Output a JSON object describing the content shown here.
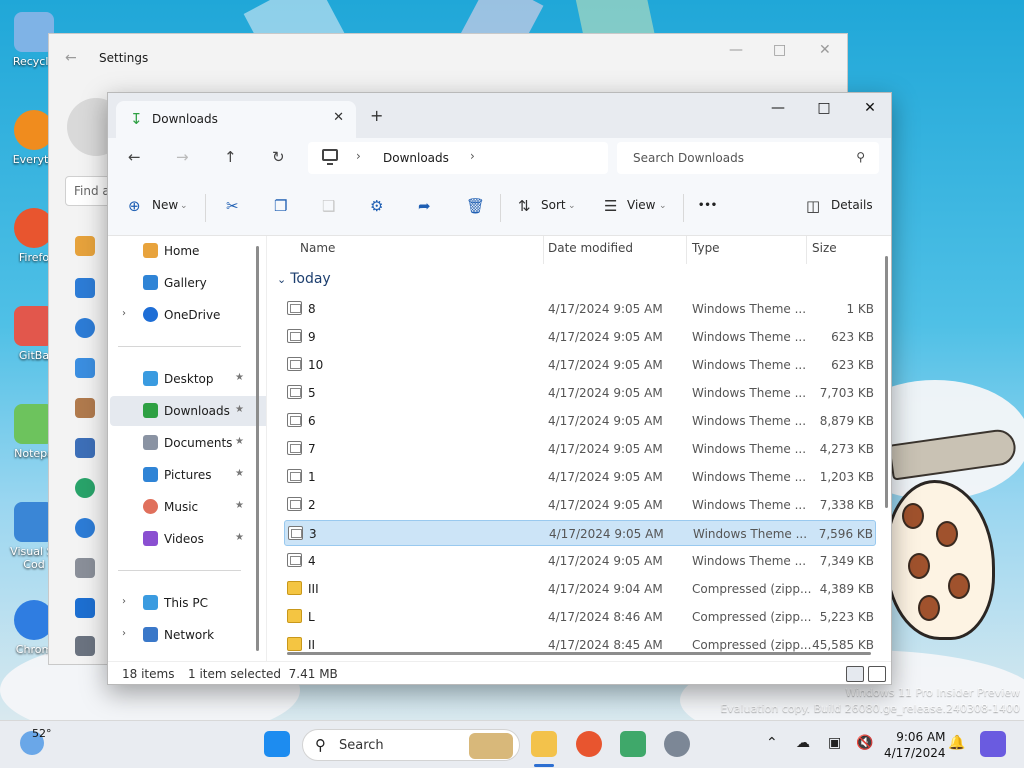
{
  "desktop": {
    "icons": [
      {
        "label": "Recycle",
        "color": "#7fb3e6"
      },
      {
        "label": "Everyth",
        "color": "#f08c1e"
      },
      {
        "label": "Firefo",
        "color": "#e8552f"
      },
      {
        "label": "GitBa",
        "color": "#e2574c"
      },
      {
        "label": "Notepa",
        "color": "#6dc35d"
      },
      {
        "label": "Visual St Cod",
        "color": "#3a86d6"
      },
      {
        "label": "Chrom",
        "color": "#2f7de1"
      }
    ],
    "watermark": {
      "line1": "Windows 11 Pro Insider Preview",
      "line2": "Evaluation copy. Build 26080.ge_release.240308-1400"
    }
  },
  "settings": {
    "title": "Settings",
    "find_placeholder": "Find a"
  },
  "explorer": {
    "tab_title": "Downloads",
    "breadcrumb": {
      "folder": "Downloads"
    },
    "search_placeholder": "Search Downloads",
    "toolbar": {
      "new_label": "New",
      "sort_label": "Sort",
      "view_label": "View",
      "more_label": "•••",
      "details_label": "Details"
    },
    "nav": {
      "quick": [
        {
          "label": "Home"
        },
        {
          "label": "Gallery"
        },
        {
          "label": "OneDrive"
        }
      ],
      "pinned": [
        {
          "label": "Desktop"
        },
        {
          "label": "Downloads"
        },
        {
          "label": "Documents"
        },
        {
          "label": "Pictures"
        },
        {
          "label": "Music"
        },
        {
          "label": "Videos"
        }
      ],
      "devices": [
        {
          "label": "This PC"
        },
        {
          "label": "Network"
        }
      ]
    },
    "columns": {
      "name": "Name",
      "date": "Date modified",
      "type": "Type",
      "size": "Size"
    },
    "group_label": "Today",
    "files": [
      {
        "name": "8",
        "date": "4/17/2024 9:05 AM",
        "type": "Windows Theme ...",
        "size": "1 KB",
        "kind": "theme"
      },
      {
        "name": "9",
        "date": "4/17/2024 9:05 AM",
        "type": "Windows Theme ...",
        "size": "623 KB",
        "kind": "theme"
      },
      {
        "name": "10",
        "date": "4/17/2024 9:05 AM",
        "type": "Windows Theme ...",
        "size": "623 KB",
        "kind": "theme"
      },
      {
        "name": "5",
        "date": "4/17/2024 9:05 AM",
        "type": "Windows Theme ...",
        "size": "7,703 KB",
        "kind": "theme"
      },
      {
        "name": "6",
        "date": "4/17/2024 9:05 AM",
        "type": "Windows Theme ...",
        "size": "8,879 KB",
        "kind": "theme"
      },
      {
        "name": "7",
        "date": "4/17/2024 9:05 AM",
        "type": "Windows Theme ...",
        "size": "4,273 KB",
        "kind": "theme"
      },
      {
        "name": "1",
        "date": "4/17/2024 9:05 AM",
        "type": "Windows Theme ...",
        "size": "1,203 KB",
        "kind": "theme"
      },
      {
        "name": "2",
        "date": "4/17/2024 9:05 AM",
        "type": "Windows Theme ...",
        "size": "7,338 KB",
        "kind": "theme"
      },
      {
        "name": "3",
        "date": "4/17/2024 9:05 AM",
        "type": "Windows Theme ...",
        "size": "7,596 KB",
        "kind": "theme",
        "selected": true
      },
      {
        "name": "4",
        "date": "4/17/2024 9:05 AM",
        "type": "Windows Theme ...",
        "size": "7,349 KB",
        "kind": "theme"
      },
      {
        "name": "III",
        "date": "4/17/2024 9:04 AM",
        "type": "Compressed (zipp...",
        "size": "4,389 KB",
        "kind": "zip"
      },
      {
        "name": "L",
        "date": "4/17/2024 8:46 AM",
        "type": "Compressed (zipp...",
        "size": "5,223 KB",
        "kind": "zip"
      },
      {
        "name": "II",
        "date": "4/17/2024 8:45 AM",
        "type": "Compressed (zipp...",
        "size": "45,585 KB",
        "kind": "zip"
      }
    ],
    "status": {
      "count": "18 items",
      "selection": "1 item selected  7.41 MB"
    }
  },
  "taskbar": {
    "weather_temp": "52°",
    "search_label": "Search",
    "time": "9:06 AM",
    "date": "4/17/2024"
  }
}
